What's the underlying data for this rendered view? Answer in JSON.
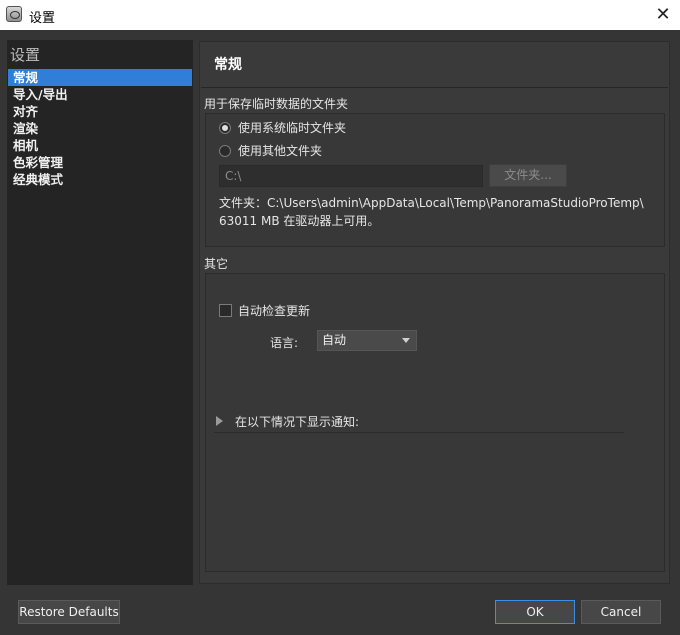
{
  "window": {
    "title": "设置",
    "icon": "panorama-studio-pro-app-icon",
    "close_glyph": "✕"
  },
  "sidebar": {
    "header": "设置",
    "items": [
      {
        "label": "常规",
        "selected": true
      },
      {
        "label": "导入/导出",
        "selected": false
      },
      {
        "label": "对齐",
        "selected": false
      },
      {
        "label": "渲染",
        "selected": false
      },
      {
        "label": "相机",
        "selected": false
      },
      {
        "label": "色彩管理",
        "selected": false
      },
      {
        "label": "经典模式",
        "selected": false
      }
    ]
  },
  "main": {
    "title": "常规",
    "temp_group": {
      "label": "用于保存临时数据的文件夹",
      "options": [
        {
          "label": "使用系统临时文件夹",
          "checked": true
        },
        {
          "label": "使用其他文件夹",
          "checked": false
        }
      ],
      "path_value": "C:\\",
      "folder_button": "文件夹...",
      "folder_info": "文件夹：C:\\Users\\admin\\AppData\\Local\\Temp\\PanoramaStudioProTemp\\",
      "space_info": "63011 MB 在驱动器上可用。"
    },
    "other_group": {
      "label": "其它",
      "auto_update": {
        "label": "自动检查更新",
        "checked": false
      },
      "language_label": "语言:",
      "language_value": "自动",
      "notify_label": "在以下情况下显示通知:"
    }
  },
  "footer": {
    "restore": "Restore Defaults",
    "ok": "OK",
    "cancel": "Cancel"
  },
  "colors": {
    "selection": "#2f7fd9",
    "background": "#353535",
    "ok_border": "#3d8ee6"
  }
}
